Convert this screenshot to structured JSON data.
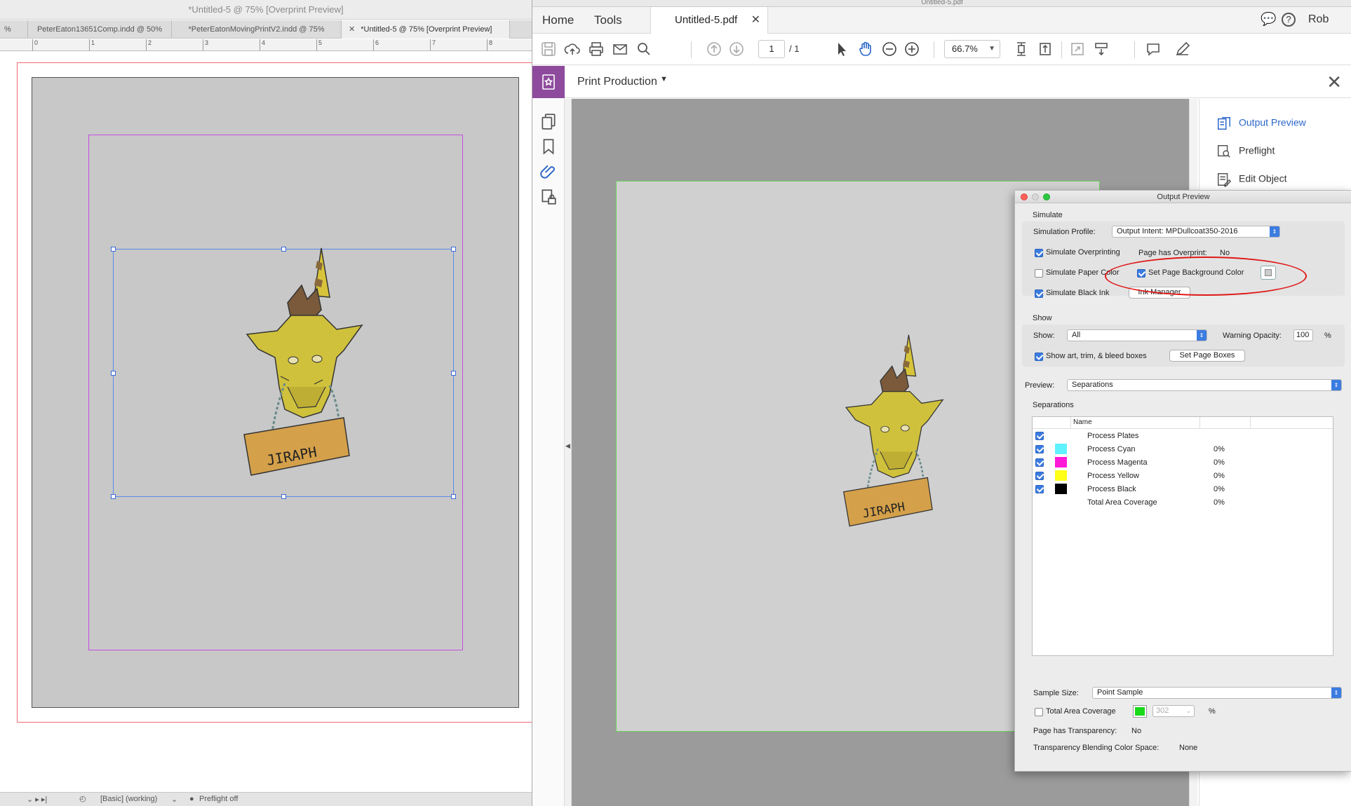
{
  "indesign": {
    "window_title": "*Untitled-5 @ 75% [Overprint Preview]",
    "tabs": [
      {
        "label": "PeterEaton13651Comp.indd @ 50%",
        "active": false
      },
      {
        "label": "*PeterEatonMovingPrintV2.indd @ 75%",
        "active": false
      },
      {
        "label": "*Untitled-5 @ 75% [Overprint Preview]",
        "active": true
      }
    ],
    "ruler_marks": [
      "0",
      "1",
      "2",
      "3",
      "4",
      "5",
      "6",
      "7",
      "8"
    ],
    "status": {
      "style": "[Basic] (working)",
      "preflight": "Preflight off"
    },
    "sign_text": "JIRAPH"
  },
  "acrobat": {
    "window_title": "Untitled-5.pdf",
    "menu": {
      "home": "Home",
      "tools": "Tools",
      "user": "Rob"
    },
    "doc_tab": "Untitled-5.pdf",
    "page_current": "1",
    "page_total": "/ 1",
    "zoom": "66.7%",
    "panel_title": "Print Production",
    "right_pane": [
      {
        "label": "Output Preview",
        "icon": "output-preview-icon",
        "active": true
      },
      {
        "label": "Preflight",
        "icon": "preflight-icon",
        "active": false
      },
      {
        "label": "Edit Object",
        "icon": "edit-object-icon",
        "active": false
      }
    ],
    "sign_text": "JIRAPH"
  },
  "output_preview": {
    "title": "Output Preview",
    "simulate_header": "Simulate",
    "simulation_profile_label": "Simulation Profile:",
    "simulation_profile_value": "Output Intent: MPDullcoat350-2016",
    "simulate_overprinting": "Simulate Overprinting",
    "page_has_overprint_label": "Page has Overprint:",
    "page_has_overprint_value": "No",
    "simulate_paper_color": "Simulate Paper Color",
    "set_page_bg_color": "Set Page Background Color",
    "simulate_black_ink": "Simulate Black Ink",
    "ink_manager": "Ink Manager",
    "show_header": "Show",
    "show_label": "Show:",
    "show_value": "All",
    "warning_opacity_label": "Warning Opacity:",
    "warning_opacity_value": "100",
    "percent": "%",
    "show_boxes": "Show art, trim, & bleed boxes",
    "set_page_boxes": "Set Page Boxes",
    "preview_label": "Preview:",
    "preview_value": "Separations",
    "separations_header": "Separations",
    "col_name": "Name",
    "separations": [
      {
        "name": "Process Plates",
        "checked": true,
        "color": "",
        "pct": ""
      },
      {
        "name": "Process Cyan",
        "checked": true,
        "color": "#5ff2ff",
        "pct": "0%"
      },
      {
        "name": "Process Magenta",
        "checked": true,
        "color": "#ff1ad8",
        "pct": "0%"
      },
      {
        "name": "Process Yellow",
        "checked": true,
        "color": "#ffff1a",
        "pct": "0%"
      },
      {
        "name": "Process Black",
        "checked": true,
        "color": "#000000",
        "pct": "0%"
      },
      {
        "name": "Total Area Coverage",
        "checked": false,
        "color": "",
        "pct": "0%"
      }
    ],
    "sample_size_label": "Sample Size:",
    "sample_size_value": "Point Sample",
    "total_area_coverage": "Total Area Coverage",
    "tac_value": "302",
    "page_has_transparency_label": "Page has Transparency:",
    "page_has_transparency_value": "No",
    "blending_space_label": "Transparency Blending Color Space:",
    "blending_space_value": "None"
  },
  "colors": {
    "acrobat_accent": "#8e4b9d",
    "link_blue": "#2a66c8",
    "highlight_circle": "#e01818"
  }
}
